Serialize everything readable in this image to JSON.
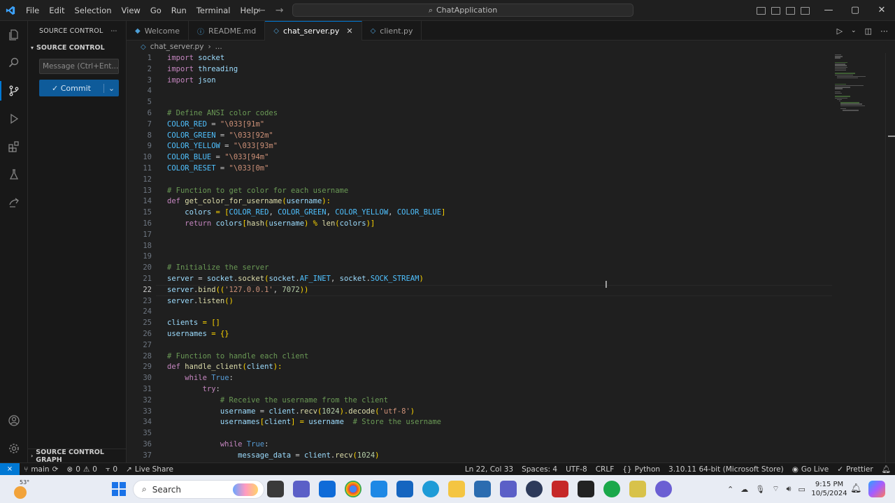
{
  "titlebar": {
    "menu": [
      "File",
      "Edit",
      "Selection",
      "View",
      "Go",
      "Run",
      "Terminal",
      "Help"
    ],
    "search_text": "ChatApplication"
  },
  "sidebar": {
    "header": "SOURCE CONTROL",
    "section": "SOURCE CONTROL",
    "message_placeholder": "Message (Ctrl+Ent...",
    "commit_label": "✓ Commit",
    "graph_label": "SOURCE CONTROL GRAPH"
  },
  "tabs": [
    {
      "label": "Welcome",
      "icon": "vscode-icon"
    },
    {
      "label": "README.md",
      "icon": "info-icon"
    },
    {
      "label": "chat_server.py",
      "icon": "python-icon",
      "active": true
    },
    {
      "label": "client.py",
      "icon": "python-icon"
    }
  ],
  "breadcrumb": {
    "file": "chat_server.py",
    "more": "..."
  },
  "editor": {
    "current_line": 22,
    "lines": [
      {
        "n": "1",
        "t": "import socket"
      },
      {
        "n": "2",
        "t": "import threading"
      },
      {
        "n": "3",
        "t": "import json"
      },
      {
        "n": "4",
        "t": ""
      },
      {
        "n": "5",
        "t": ""
      },
      {
        "n": "6",
        "t": "# Define ANSI color codes"
      },
      {
        "n": "7",
        "t": "COLOR_RED = \"\\033[91m\""
      },
      {
        "n": "8",
        "t": "COLOR_GREEN = \"\\033[92m\""
      },
      {
        "n": "9",
        "t": "COLOR_YELLOW = \"\\033[93m\""
      },
      {
        "n": "10",
        "t": "COLOR_BLUE = \"\\033[94m\""
      },
      {
        "n": "11",
        "t": "COLOR_RESET = \"\\033[0m\""
      },
      {
        "n": "12",
        "t": ""
      },
      {
        "n": "13",
        "t": "# Function to get color for each username"
      },
      {
        "n": "14",
        "t": "def get_color_for_username(username):"
      },
      {
        "n": "15",
        "t": "    colors = [COLOR_RED, COLOR_GREEN, COLOR_YELLOW, COLOR_BLUE]"
      },
      {
        "n": "16",
        "t": "    return colors[hash(username) % len(colors)]"
      },
      {
        "n": "17",
        "t": ""
      },
      {
        "n": "18",
        "t": ""
      },
      {
        "n": "19",
        "t": ""
      },
      {
        "n": "20",
        "t": "# Initialize the server"
      },
      {
        "n": "21",
        "t": "server = socket.socket(socket.AF_INET, socket.SOCK_STREAM)"
      },
      {
        "n": "22",
        "t": "server.bind(('127.0.0.1', 7072))"
      },
      {
        "n": "23",
        "t": "server.listen()"
      },
      {
        "n": "24",
        "t": ""
      },
      {
        "n": "25",
        "t": "clients = []"
      },
      {
        "n": "26",
        "t": "usernames = {}"
      },
      {
        "n": "27",
        "t": ""
      },
      {
        "n": "28",
        "t": "# Function to handle each client"
      },
      {
        "n": "29",
        "t": "def handle_client(client):"
      },
      {
        "n": "30",
        "t": "    while True:"
      },
      {
        "n": "31",
        "t": "        try:"
      },
      {
        "n": "32",
        "t": "            # Receive the username from the client"
      },
      {
        "n": "33",
        "t": "            username = client.recv(1024).decode('utf-8')"
      },
      {
        "n": "34",
        "t": "            usernames[client] = username  # Store the username"
      },
      {
        "n": "35",
        "t": ""
      },
      {
        "n": "36",
        "t": "            while True:"
      },
      {
        "n": "37",
        "t": "                message_data = client.recv(1024)"
      }
    ]
  },
  "statusbar": {
    "branch": "main",
    "errors": "0",
    "warnings": "0",
    "ports": "0",
    "live_share": "Live Share",
    "position": "Ln 22, Col 33",
    "spaces": "Spaces: 4",
    "encoding": "UTF-8",
    "eol": "CRLF",
    "language": "Python",
    "interpreter": "3.10.11 64-bit (Microsoft Store)",
    "go_live": "Go Live",
    "prettier": "Prettier"
  },
  "taskbar": {
    "weather_temp": "53°",
    "search_label": "Search",
    "time": "9:15 PM",
    "date": "10/5/2024"
  }
}
